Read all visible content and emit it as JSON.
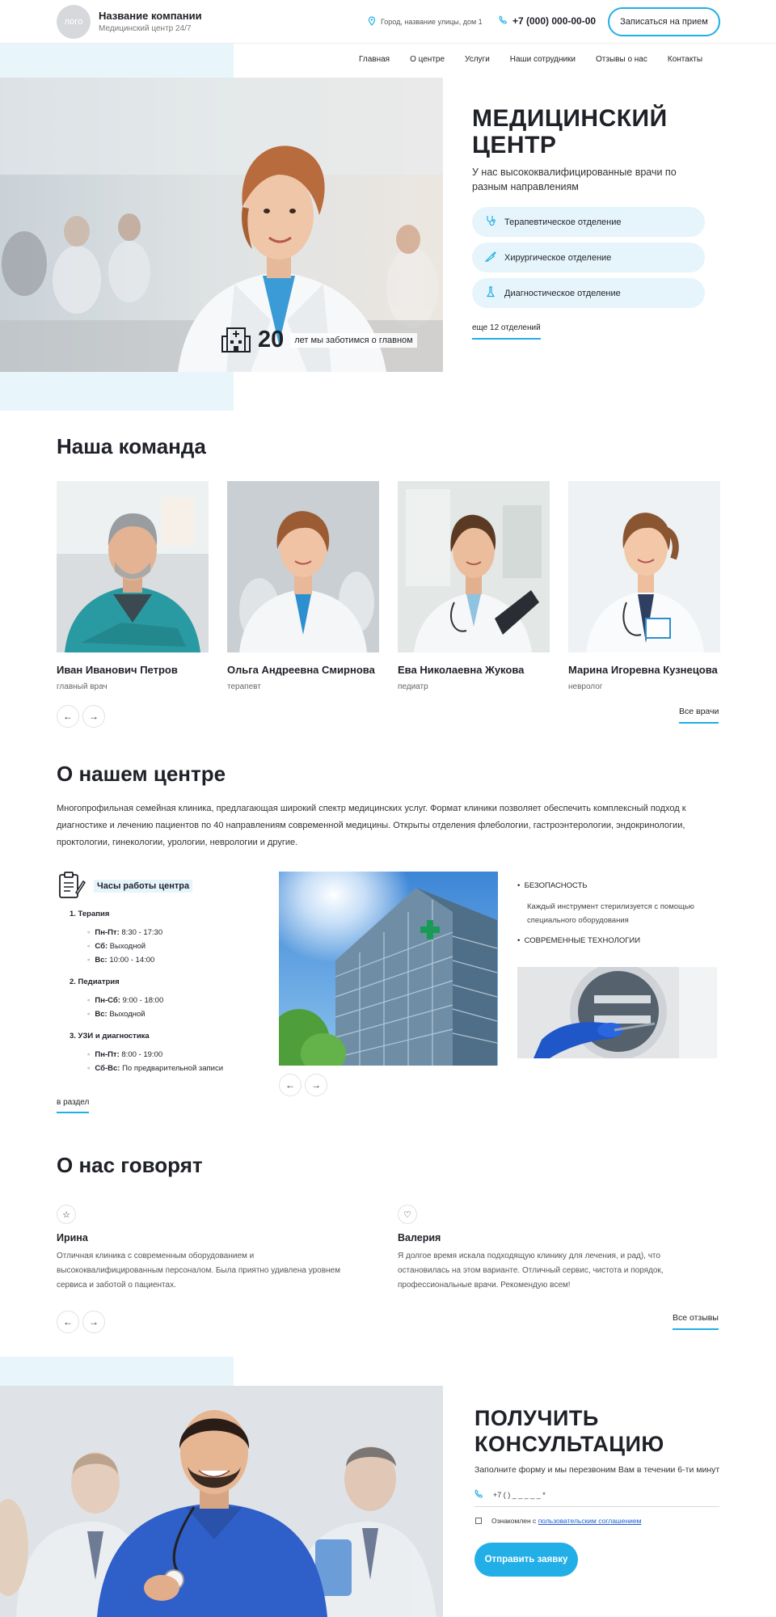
{
  "header": {
    "logo": "логo",
    "company_name": "Название компании",
    "company_sub": "Медицинский центр 24/7",
    "address": "Город, название улицы, дом 1",
    "phone": "+7 (000) 000-00-00",
    "record_button": "Записаться на прием"
  },
  "nav": [
    "Главная",
    "О центре",
    "Услуги",
    "Наши сотрудники",
    "Отзывы о нас",
    "Контакты"
  ],
  "hero": {
    "title": "МЕДИЦИНСКИЙ ЦЕНТР",
    "subtitle": "У нас высококвалифицированные врачи по разным направлениям",
    "badge_number": "20",
    "badge_text": "лет мы заботимся о главном",
    "departments": [
      "Терапевтическое отделение",
      "Хирургическое отделение",
      "Диагностическое отделение"
    ],
    "more_link": "еще 12 отделений"
  },
  "team": {
    "title": "Наша команда",
    "doctors": [
      {
        "name": "Иван Иванович Петров",
        "role": "главный врач"
      },
      {
        "name": "Ольга Андреевна Смирнова",
        "role": "терапевт"
      },
      {
        "name": "Ева Николаевна Жукова",
        "role": "педиатр"
      },
      {
        "name": "Марина Игоревна Кузнецова",
        "role": "невролог"
      }
    ],
    "all_link": "Все врачи"
  },
  "about": {
    "title": "О нашем центре",
    "text": "Многопрофильная семейная клиника, предлагающая широкий спектр медицинских услуг. Формат клиники позволяет обеспечить комплексный подход к диагностике и лечению пациентов по 40 направлениям современной медицины. Открыты отделения флебологии, гастроэнтерологии, эндокринологии, проктологии, гинекологии, урологии, неврологии и другие.",
    "hours_title": "Часы работы центра",
    "groups": [
      {
        "name": "1. Терапия",
        "items": [
          {
            "days": "Пн-Пт:",
            "time": "8:30 - 17:30"
          },
          {
            "days": "Сб:",
            "time": "Выходной"
          },
          {
            "days": "Вс:",
            "time": "10:00 - 14:00"
          }
        ]
      },
      {
        "name": "2. Педиатрия",
        "items": [
          {
            "days": "Пн-Сб:",
            "time": "9:00 - 18:00"
          },
          {
            "days": "Вс:",
            "time": "Выходной"
          }
        ]
      },
      {
        "name": "3. УЗИ и диагностика",
        "items": [
          {
            "days": "Пн-Пт:",
            "time": "8:00 - 19:00"
          },
          {
            "days": "Сб-Вс:",
            "time": "По предварительной записи"
          }
        ]
      }
    ],
    "section_link": "в раздел",
    "feature_1": "БЕЗОПАСНОСТЬ",
    "feature_1_desc": "Каждый инструмент стерилизуется с помощью специального оборудования",
    "feature_2": "СОВРЕМЕННЫЕ ТЕХНОЛОГИИ"
  },
  "reviews": {
    "title": "О нас говорят",
    "items": [
      {
        "name": "Ирина",
        "icon": "star-icon",
        "text": "Отличная клиника с современным оборудованием и высококвалифицированным персоналом. Была приятно удивлена уровнем сервиса и заботой о пациентах."
      },
      {
        "name": "Валерия",
        "icon": "heart-icon",
        "text": "Я долгое время искала подходящую клинику для лечения, и рад), что остановилась на этом варианте. Отличный сервис, чистота и порядок, профессиональные врачи. Рекомендую всем!"
      }
    ],
    "all_link": "Все отзывы"
  },
  "consult": {
    "title": "ПОЛУЧИТЬ КОНСУЛЬТАЦИЮ",
    "subtitle": "Заполните форму и мы перезвоним Вам в течении 6-ти минут",
    "phone_placeholder": "+7 (    ) _ _ _ _ _ *",
    "agree_text": "Ознакомлен с",
    "agree_link": "пользовательским соглашением",
    "submit": "Отправить заявку"
  },
  "colors": {
    "accent": "#22aee6",
    "tint": "#e8f6fc",
    "text": "#1f2128"
  }
}
